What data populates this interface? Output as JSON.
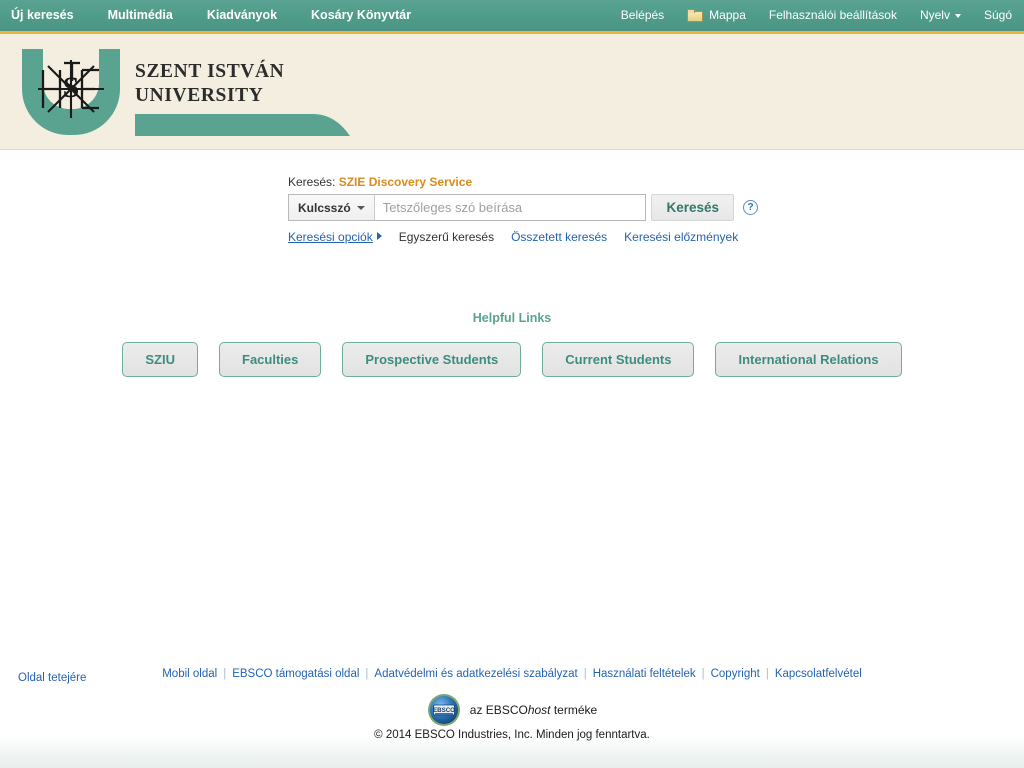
{
  "top_nav": {
    "left_items": [
      {
        "label": "Új keresés",
        "name": "nav-new-search"
      },
      {
        "label": "Multimédia",
        "name": "nav-multimedia"
      },
      {
        "label": "Kiadványok",
        "name": "nav-publications"
      },
      {
        "label": "Kosáry Könyvtár",
        "name": "nav-kosary-library"
      }
    ],
    "right_items": [
      {
        "label": "Belépés",
        "name": "nav-sign-in",
        "icon": null,
        "caret": false
      },
      {
        "label": "Mappa",
        "name": "nav-folder",
        "icon": "folder-icon",
        "caret": false
      },
      {
        "label": "Felhasználói beállítások",
        "name": "nav-preferences",
        "icon": null,
        "caret": false
      },
      {
        "label": "Nyelv",
        "name": "nav-language",
        "icon": null,
        "caret": true
      },
      {
        "label": "Súgó",
        "name": "nav-help",
        "icon": null,
        "caret": false
      }
    ]
  },
  "brand": {
    "line1": "SZENT ISTVÁN",
    "line2": "UNIVERSITY"
  },
  "search": {
    "label_prefix": "Keresés:",
    "database_name": "SZIE Discovery Service",
    "field_select_value": "Kulcsszó",
    "input_value": "",
    "input_placeholder": "Tetszőleges szó beírása",
    "search_button": "Keresés",
    "help_glyph": "?",
    "links": [
      {
        "label": "Keresési opciók",
        "name": "link-search-options",
        "style": "underlined",
        "arrow": true
      },
      {
        "label": "Egyszerű keresés",
        "name": "link-basic-search",
        "style": "current",
        "arrow": false
      },
      {
        "label": "Összetett keresés",
        "name": "link-advanced-search",
        "style": "link",
        "arrow": false
      },
      {
        "label": "Keresési előzmények",
        "name": "link-search-history",
        "style": "link",
        "arrow": false
      }
    ]
  },
  "helpful_links": {
    "title": "Helpful Links",
    "buttons": [
      {
        "label": "SZIU",
        "name": "helpful-link-sziu"
      },
      {
        "label": "Faculties",
        "name": "helpful-link-faculties"
      },
      {
        "label": "Prospective Students",
        "name": "helpful-link-prospective-students"
      },
      {
        "label": "Current Students",
        "name": "helpful-link-current-students"
      },
      {
        "label": "International Relations",
        "name": "helpful-link-international-relations"
      }
    ]
  },
  "footer": {
    "back_to_top": "Oldal tetejére",
    "links": [
      {
        "label": "Mobil oldal",
        "name": "footer-link-mobile-site"
      },
      {
        "label": "EBSCO támogatási oldal",
        "name": "footer-link-ebsco-support"
      },
      {
        "label": "Adatvédelmi és adatkezelési szabályzat",
        "name": "footer-link-privacy-policy"
      },
      {
        "label": "Használati feltételek",
        "name": "footer-link-terms-of-use"
      },
      {
        "label": "Copyright",
        "name": "footer-link-copyright"
      },
      {
        "label": "Kapcsolatfelvétel",
        "name": "footer-link-contact"
      }
    ],
    "ebsco_prefix": "az EBSCO",
    "ebsco_italic": "host",
    "ebsco_suffix": " terméke",
    "copyright": "© 2014 EBSCO Industries, Inc. Minden jog fenntartva."
  },
  "colors": {
    "teal_bar": "#4f9c8a",
    "gold_rule": "#e9b53f",
    "cream_banner": "#f4eee0",
    "brand_teal": "#5aa391",
    "link_blue": "#2463b0",
    "db_orange": "#d98b1d",
    "button_teal_text": "#3d8d7c"
  }
}
